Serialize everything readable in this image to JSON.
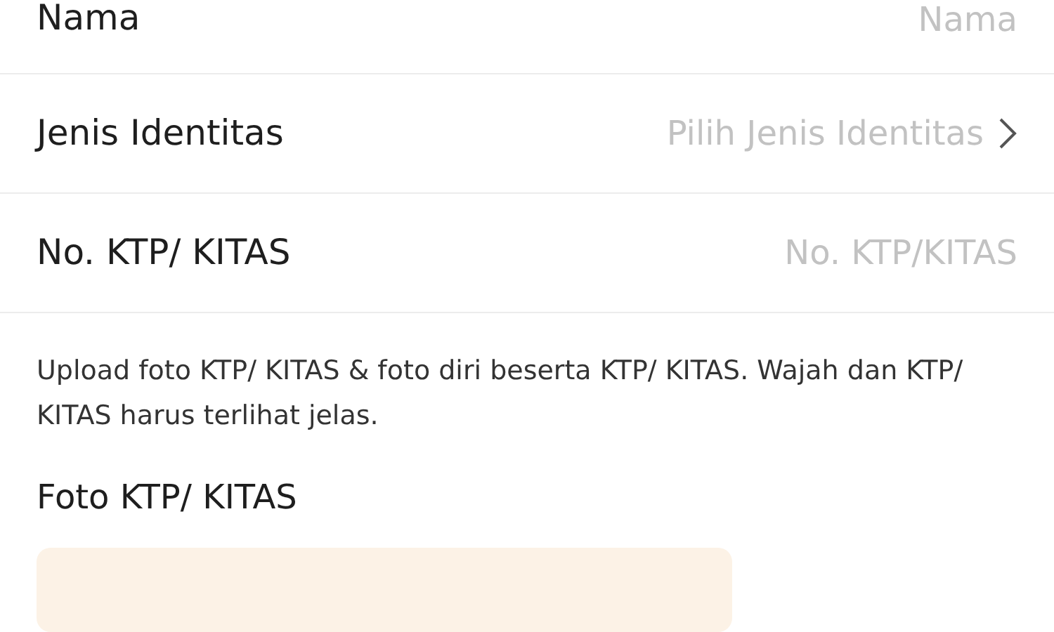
{
  "fields": [
    {
      "kind": "text",
      "label": "Nama",
      "placeholder": "Nama"
    },
    {
      "kind": "select",
      "label": "Jenis Identitas",
      "placeholder": "Pilih Jenis Identitas"
    },
    {
      "kind": "text",
      "label": "No. KTP/ KITAS",
      "placeholder": "No. KTP/KITAS"
    }
  ],
  "instructions": "Upload foto KTP/ KITAS & foto diri beserta KTP/ KITAS. Wajah dan KTP/ KITAS harus terlihat jelas.",
  "photo_section": {
    "title": "Foto KTP/ KITAS",
    "kind": "upload"
  }
}
